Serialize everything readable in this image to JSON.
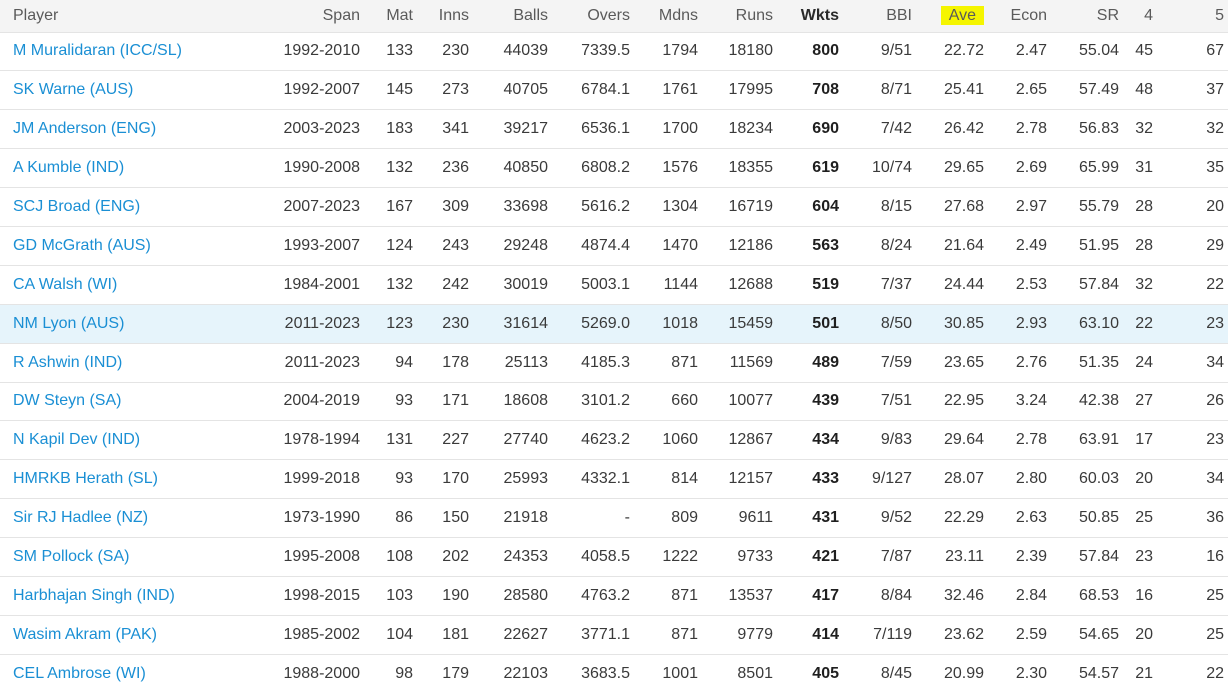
{
  "columns": [
    {
      "label": "Player"
    },
    {
      "label": "Span"
    },
    {
      "label": "Mat"
    },
    {
      "label": "Inns"
    },
    {
      "label": "Balls"
    },
    {
      "label": "Overs"
    },
    {
      "label": "Mdns"
    },
    {
      "label": "Runs"
    },
    {
      "label": "Wkts"
    },
    {
      "label": "BBI"
    },
    {
      "label": "Ave"
    },
    {
      "label": "Econ"
    },
    {
      "label": "SR"
    },
    {
      "label": "4"
    },
    {
      "label": "5"
    }
  ],
  "highlight_color": "#f5f500",
  "row_highlight_color": "#e6f4fb",
  "link_color": "#1a8fd4",
  "highlighted_row_index": 7,
  "rows": [
    [
      "M Muralidaran (ICC/SL)",
      "1992-2010",
      "133",
      "230",
      "44039",
      "7339.5",
      "1794",
      "18180",
      "800",
      "9/51",
      "22.72",
      "2.47",
      "55.04",
      "45",
      "67"
    ],
    [
      "SK Warne (AUS)",
      "1992-2007",
      "145",
      "273",
      "40705",
      "6784.1",
      "1761",
      "17995",
      "708",
      "8/71",
      "25.41",
      "2.65",
      "57.49",
      "48",
      "37"
    ],
    [
      "JM Anderson (ENG)",
      "2003-2023",
      "183",
      "341",
      "39217",
      "6536.1",
      "1700",
      "18234",
      "690",
      "7/42",
      "26.42",
      "2.78",
      "56.83",
      "32",
      "32"
    ],
    [
      "A Kumble (IND)",
      "1990-2008",
      "132",
      "236",
      "40850",
      "6808.2",
      "1576",
      "18355",
      "619",
      "10/74",
      "29.65",
      "2.69",
      "65.99",
      "31",
      "35"
    ],
    [
      "SCJ Broad (ENG)",
      "2007-2023",
      "167",
      "309",
      "33698",
      "5616.2",
      "1304",
      "16719",
      "604",
      "8/15",
      "27.68",
      "2.97",
      "55.79",
      "28",
      "20"
    ],
    [
      "GD McGrath (AUS)",
      "1993-2007",
      "124",
      "243",
      "29248",
      "4874.4",
      "1470",
      "12186",
      "563",
      "8/24",
      "21.64",
      "2.49",
      "51.95",
      "28",
      "29"
    ],
    [
      "CA Walsh (WI)",
      "1984-2001",
      "132",
      "242",
      "30019",
      "5003.1",
      "1144",
      "12688",
      "519",
      "7/37",
      "24.44",
      "2.53",
      "57.84",
      "32",
      "22"
    ],
    [
      "NM Lyon (AUS)",
      "2011-2023",
      "123",
      "230",
      "31614",
      "5269.0",
      "1018",
      "15459",
      "501",
      "8/50",
      "30.85",
      "2.93",
      "63.10",
      "22",
      "23"
    ],
    [
      "R Ashwin (IND)",
      "2011-2023",
      "94",
      "178",
      "25113",
      "4185.3",
      "871",
      "11569",
      "489",
      "7/59",
      "23.65",
      "2.76",
      "51.35",
      "24",
      "34"
    ],
    [
      "DW Steyn (SA)",
      "2004-2019",
      "93",
      "171",
      "18608",
      "3101.2",
      "660",
      "10077",
      "439",
      "7/51",
      "22.95",
      "3.24",
      "42.38",
      "27",
      "26"
    ],
    [
      "N Kapil Dev (IND)",
      "1978-1994",
      "131",
      "227",
      "27740",
      "4623.2",
      "1060",
      "12867",
      "434",
      "9/83",
      "29.64",
      "2.78",
      "63.91",
      "17",
      "23"
    ],
    [
      "HMRKB Herath (SL)",
      "1999-2018",
      "93",
      "170",
      "25993",
      "4332.1",
      "814",
      "12157",
      "433",
      "9/127",
      "28.07",
      "2.80",
      "60.03",
      "20",
      "34"
    ],
    [
      "Sir RJ Hadlee (NZ)",
      "1973-1990",
      "86",
      "150",
      "21918",
      "-",
      "809",
      "9611",
      "431",
      "9/52",
      "22.29",
      "2.63",
      "50.85",
      "25",
      "36"
    ],
    [
      "SM Pollock (SA)",
      "1995-2008",
      "108",
      "202",
      "24353",
      "4058.5",
      "1222",
      "9733",
      "421",
      "7/87",
      "23.11",
      "2.39",
      "57.84",
      "23",
      "16"
    ],
    [
      "Harbhajan Singh (IND)",
      "1998-2015",
      "103",
      "190",
      "28580",
      "4763.2",
      "871",
      "13537",
      "417",
      "8/84",
      "32.46",
      "2.84",
      "68.53",
      "16",
      "25"
    ],
    [
      "Wasim Akram (PAK)",
      "1985-2002",
      "104",
      "181",
      "22627",
      "3771.1",
      "871",
      "9779",
      "414",
      "7/119",
      "23.62",
      "2.59",
      "54.65",
      "20",
      "25"
    ],
    [
      "CEL Ambrose (WI)",
      "1988-2000",
      "98",
      "179",
      "22103",
      "3683.5",
      "1001",
      "8501",
      "405",
      "8/45",
      "20.99",
      "2.30",
      "54.57",
      "21",
      "22"
    ]
  ]
}
